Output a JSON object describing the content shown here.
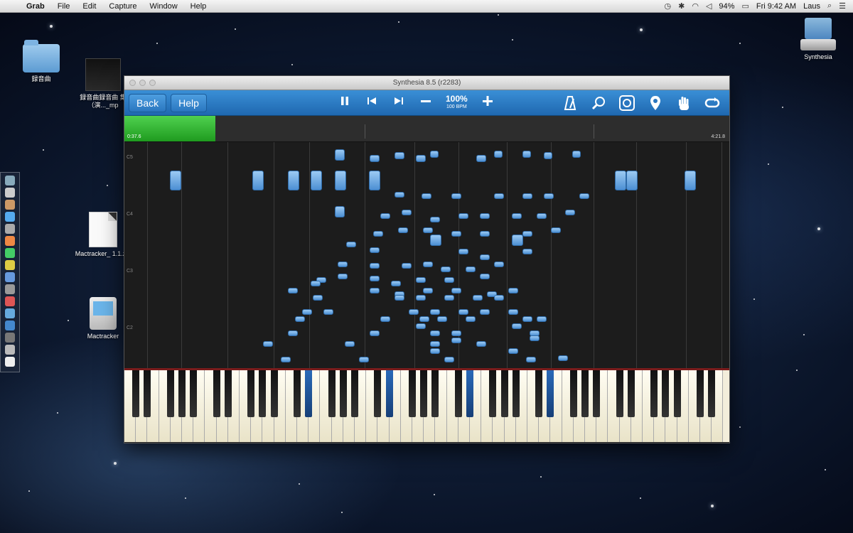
{
  "menubar": {
    "app": "Grab",
    "items": [
      "File",
      "Edit",
      "Capture",
      "Window",
      "Help"
    ],
    "battery": "94%",
    "clock": "Fri 9:42 AM",
    "user": "Laus"
  },
  "desktop": {
    "icons": [
      {
        "name": "folder",
        "label": "録音曲"
      },
      {
        "name": "thumbnail",
        "label": "録音曲録音曲 集（演..._mp"
      },
      {
        "name": "zip",
        "label": "Mactracker_ 1.1.zip"
      },
      {
        "name": "app",
        "label": "Mactracker"
      },
      {
        "name": "drive",
        "label": "Synthesia"
      }
    ]
  },
  "window": {
    "title": "Synthesia 8.5 (r2283)",
    "toolbar": {
      "back": "Back",
      "help": "Help",
      "speed_pct": "100%",
      "speed_bpm": "100 BPM"
    },
    "progress": {
      "current": "0:37.6",
      "total": "4:21.8",
      "fraction": 0.15
    },
    "octaves": [
      "C5",
      "C4",
      "C3",
      "C2"
    ]
  }
}
